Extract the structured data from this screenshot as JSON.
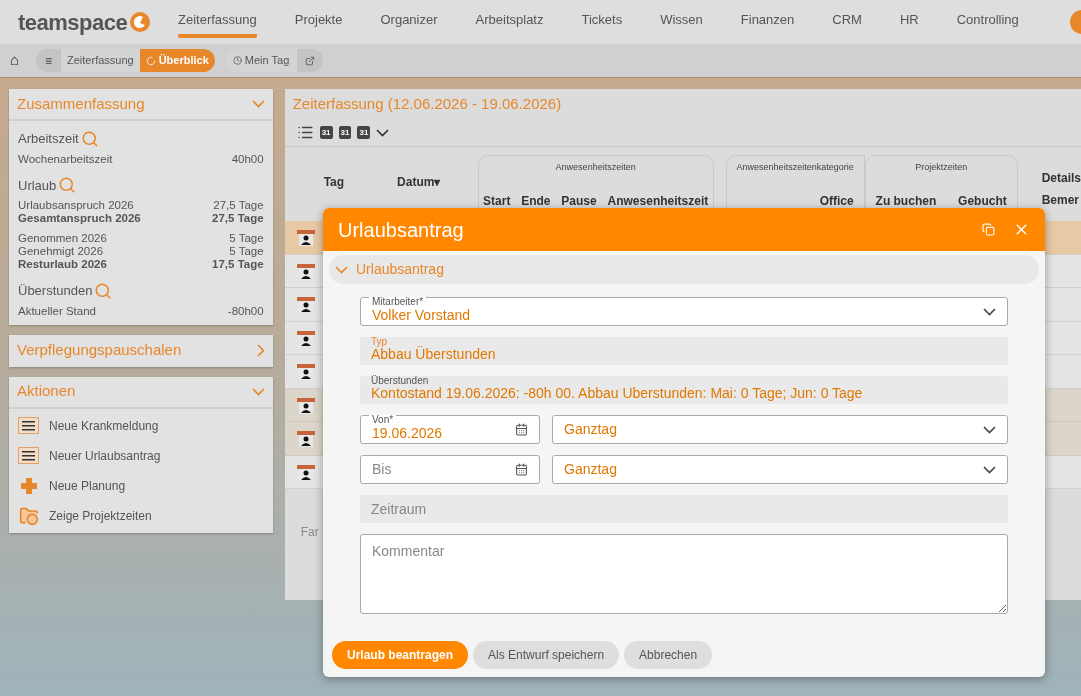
{
  "logo": "teamspace",
  "nav": [
    {
      "label": "Zeiterfassung",
      "selected": true
    },
    {
      "label": "Projekte",
      "selected": false
    },
    {
      "label": "Organizer",
      "selected": false
    },
    {
      "label": "Arbeitsplatz",
      "selected": false
    },
    {
      "label": "Tickets",
      "selected": false
    },
    {
      "label": "Wissen",
      "selected": false
    },
    {
      "label": "Finanzen",
      "selected": false
    },
    {
      "label": "CRM",
      "selected": false
    },
    {
      "label": "HR",
      "selected": false
    },
    {
      "label": "Controlling",
      "selected": false
    }
  ],
  "toolbar": {
    "home": "⌂",
    "menu": "≡",
    "views": [
      {
        "label": "Zeiterfassung",
        "selected": false
      },
      {
        "label": "Überblick",
        "selected": true
      }
    ],
    "my_day": "Mein Tag"
  },
  "sidebar": [
    {
      "kind": "summary",
      "title": "Zusammenfassung",
      "expanded": true,
      "groups": [
        {
          "title": "Arbeitszeit",
          "blocks": [
            [
              {
                "label": "Wochenarbeitszeit",
                "value": "40h00",
                "bold": false
              }
            ]
          ]
        },
        {
          "title": "Urlaub",
          "blocks": [
            [
              {
                "label": "Urlaubsanspruch 2026",
                "value": "27,5 Tage",
                "bold": false
              },
              {
                "label": "Gesamtanspruch 2026",
                "value": "27,5 Tage",
                "bold": true
              }
            ],
            [
              {
                "label": "Genommen 2026",
                "value": "5 Tage",
                "bold": false
              },
              {
                "label": "Genehmigt 2026",
                "value": "5 Tage",
                "bold": false
              },
              {
                "label": "Resturlaub 2026",
                "value": "17,5 Tage",
                "bold": true
              }
            ]
          ]
        },
        {
          "title": "Überstunden",
          "blocks": [
            [
              {
                "label": "Aktueller Stand",
                "value": "-80h00",
                "bold": false
              }
            ]
          ]
        }
      ]
    },
    {
      "kind": "collapsed",
      "title": "Verpflegungspauschalen",
      "expanded": false
    },
    {
      "kind": "actions",
      "title": "Aktionen",
      "expanded": true,
      "items": [
        {
          "kind": "form",
          "label": "Neue Krankmeldung"
        },
        {
          "kind": "form",
          "label": "Neuer Urlaubsantrag"
        },
        {
          "kind": "plus",
          "label": "Neue Planung"
        },
        {
          "kind": "folder-clock",
          "label": "Zeige Projektzeiten"
        }
      ]
    }
  ],
  "main": {
    "title": "Zeiterfassung (12.06.2026 - 19.06.2026)",
    "view_buttons": [
      {
        "kind": "list"
      },
      {
        "kind": "calendar",
        "label": "31"
      },
      {
        "kind": "calendar",
        "label": "31"
      },
      {
        "kind": "calendar",
        "label": "31"
      },
      {
        "kind": "more"
      }
    ],
    "table": {
      "lead_columns": [
        "Tag",
        "Datum▾"
      ],
      "groups": [
        {
          "title": "Anwesenheitszeiten",
          "columns": [
            "Start",
            "Ende",
            "Pause",
            "Anwesenheitszeit"
          ]
        },
        {
          "title": "Anwesenheitszeitenkategorie",
          "columns": [
            "Office"
          ]
        },
        {
          "title": "Projektzeiten",
          "columns": [
            "Zu buchen",
            "Gebucht"
          ]
        }
      ],
      "tail_columns": [
        "Details",
        "Bemer"
      ],
      "rows": [
        {
          "selected": true,
          "shaded": false
        },
        {
          "selected": false,
          "shaded": false
        },
        {
          "selected": false,
          "shaded": false
        },
        {
          "selected": false,
          "shaded": false
        },
        {
          "selected": false,
          "shaded": false
        },
        {
          "selected": false,
          "shaded": true
        },
        {
          "selected": false,
          "shaded": true
        },
        {
          "selected": false,
          "shaded": false
        }
      ],
      "footer": "Far"
    }
  },
  "dialog": {
    "title": "Urlaubsantrag",
    "section": {
      "title": "Urlaubsantrag",
      "expanded": true
    },
    "fields": [
      {
        "kind": "select",
        "label": "Mitarbeiter*",
        "value": "Volker Vorstand"
      },
      {
        "kind": "readonly",
        "label": "Typ",
        "value": "Abbau Überstunden"
      },
      {
        "kind": "readonly",
        "label": "Überstunden",
        "value": "Kontostand 19.06.2026: -80h 00. Abbau Uberstunden: Mai: 0 Tage; Jun: 0 Tage"
      },
      {
        "kind": "date-select",
        "label": "Von*",
        "value": "19.06.2026",
        "option": "Ganztag"
      },
      {
        "kind": "date-select",
        "placeholder": "Bis",
        "option": "Ganztag"
      },
      {
        "kind": "readonly",
        "placeholder": "Zeitraum"
      },
      {
        "kind": "textarea",
        "placeholder": "Kommentar"
      }
    ],
    "buttons": [
      {
        "label": "Urlaub beantragen",
        "kind": "primary"
      },
      {
        "label": "Als Entwurf speichern",
        "kind": "secondary"
      },
      {
        "label": "Abbrechen",
        "kind": "secondary"
      }
    ]
  }
}
